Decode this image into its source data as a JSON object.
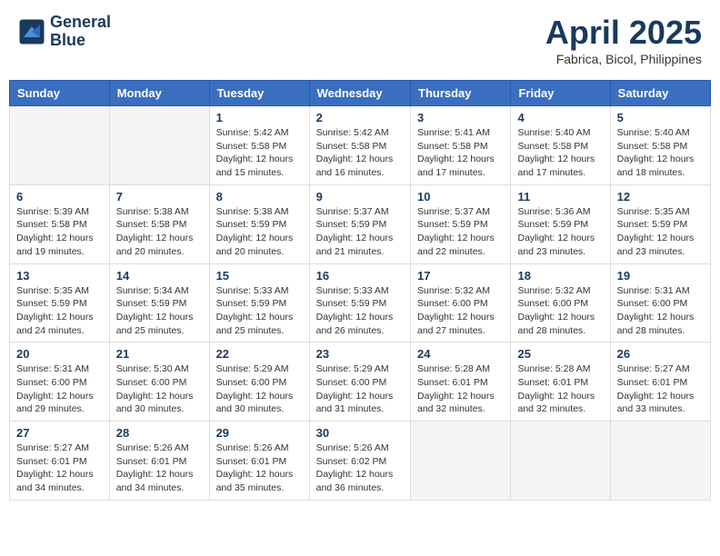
{
  "header": {
    "logo_line1": "General",
    "logo_line2": "Blue",
    "month_year": "April 2025",
    "location": "Fabrica, Bicol, Philippines"
  },
  "weekdays": [
    "Sunday",
    "Monday",
    "Tuesday",
    "Wednesday",
    "Thursday",
    "Friday",
    "Saturday"
  ],
  "weeks": [
    [
      {
        "day": "",
        "info": ""
      },
      {
        "day": "",
        "info": ""
      },
      {
        "day": "1",
        "info": "Sunrise: 5:42 AM\nSunset: 5:58 PM\nDaylight: 12 hours and 15 minutes."
      },
      {
        "day": "2",
        "info": "Sunrise: 5:42 AM\nSunset: 5:58 PM\nDaylight: 12 hours and 16 minutes."
      },
      {
        "day": "3",
        "info": "Sunrise: 5:41 AM\nSunset: 5:58 PM\nDaylight: 12 hours and 17 minutes."
      },
      {
        "day": "4",
        "info": "Sunrise: 5:40 AM\nSunset: 5:58 PM\nDaylight: 12 hours and 17 minutes."
      },
      {
        "day": "5",
        "info": "Sunrise: 5:40 AM\nSunset: 5:58 PM\nDaylight: 12 hours and 18 minutes."
      }
    ],
    [
      {
        "day": "6",
        "info": "Sunrise: 5:39 AM\nSunset: 5:58 PM\nDaylight: 12 hours and 19 minutes."
      },
      {
        "day": "7",
        "info": "Sunrise: 5:38 AM\nSunset: 5:58 PM\nDaylight: 12 hours and 20 minutes."
      },
      {
        "day": "8",
        "info": "Sunrise: 5:38 AM\nSunset: 5:59 PM\nDaylight: 12 hours and 20 minutes."
      },
      {
        "day": "9",
        "info": "Sunrise: 5:37 AM\nSunset: 5:59 PM\nDaylight: 12 hours and 21 minutes."
      },
      {
        "day": "10",
        "info": "Sunrise: 5:37 AM\nSunset: 5:59 PM\nDaylight: 12 hours and 22 minutes."
      },
      {
        "day": "11",
        "info": "Sunrise: 5:36 AM\nSunset: 5:59 PM\nDaylight: 12 hours and 23 minutes."
      },
      {
        "day": "12",
        "info": "Sunrise: 5:35 AM\nSunset: 5:59 PM\nDaylight: 12 hours and 23 minutes."
      }
    ],
    [
      {
        "day": "13",
        "info": "Sunrise: 5:35 AM\nSunset: 5:59 PM\nDaylight: 12 hours and 24 minutes."
      },
      {
        "day": "14",
        "info": "Sunrise: 5:34 AM\nSunset: 5:59 PM\nDaylight: 12 hours and 25 minutes."
      },
      {
        "day": "15",
        "info": "Sunrise: 5:33 AM\nSunset: 5:59 PM\nDaylight: 12 hours and 25 minutes."
      },
      {
        "day": "16",
        "info": "Sunrise: 5:33 AM\nSunset: 5:59 PM\nDaylight: 12 hours and 26 minutes."
      },
      {
        "day": "17",
        "info": "Sunrise: 5:32 AM\nSunset: 6:00 PM\nDaylight: 12 hours and 27 minutes."
      },
      {
        "day": "18",
        "info": "Sunrise: 5:32 AM\nSunset: 6:00 PM\nDaylight: 12 hours and 28 minutes."
      },
      {
        "day": "19",
        "info": "Sunrise: 5:31 AM\nSunset: 6:00 PM\nDaylight: 12 hours and 28 minutes."
      }
    ],
    [
      {
        "day": "20",
        "info": "Sunrise: 5:31 AM\nSunset: 6:00 PM\nDaylight: 12 hours and 29 minutes."
      },
      {
        "day": "21",
        "info": "Sunrise: 5:30 AM\nSunset: 6:00 PM\nDaylight: 12 hours and 30 minutes."
      },
      {
        "day": "22",
        "info": "Sunrise: 5:29 AM\nSunset: 6:00 PM\nDaylight: 12 hours and 30 minutes."
      },
      {
        "day": "23",
        "info": "Sunrise: 5:29 AM\nSunset: 6:00 PM\nDaylight: 12 hours and 31 minutes."
      },
      {
        "day": "24",
        "info": "Sunrise: 5:28 AM\nSunset: 6:01 PM\nDaylight: 12 hours and 32 minutes."
      },
      {
        "day": "25",
        "info": "Sunrise: 5:28 AM\nSunset: 6:01 PM\nDaylight: 12 hours and 32 minutes."
      },
      {
        "day": "26",
        "info": "Sunrise: 5:27 AM\nSunset: 6:01 PM\nDaylight: 12 hours and 33 minutes."
      }
    ],
    [
      {
        "day": "27",
        "info": "Sunrise: 5:27 AM\nSunset: 6:01 PM\nDaylight: 12 hours and 34 minutes."
      },
      {
        "day": "28",
        "info": "Sunrise: 5:26 AM\nSunset: 6:01 PM\nDaylight: 12 hours and 34 minutes."
      },
      {
        "day": "29",
        "info": "Sunrise: 5:26 AM\nSunset: 6:01 PM\nDaylight: 12 hours and 35 minutes."
      },
      {
        "day": "30",
        "info": "Sunrise: 5:26 AM\nSunset: 6:02 PM\nDaylight: 12 hours and 36 minutes."
      },
      {
        "day": "",
        "info": ""
      },
      {
        "day": "",
        "info": ""
      },
      {
        "day": "",
        "info": ""
      }
    ]
  ]
}
